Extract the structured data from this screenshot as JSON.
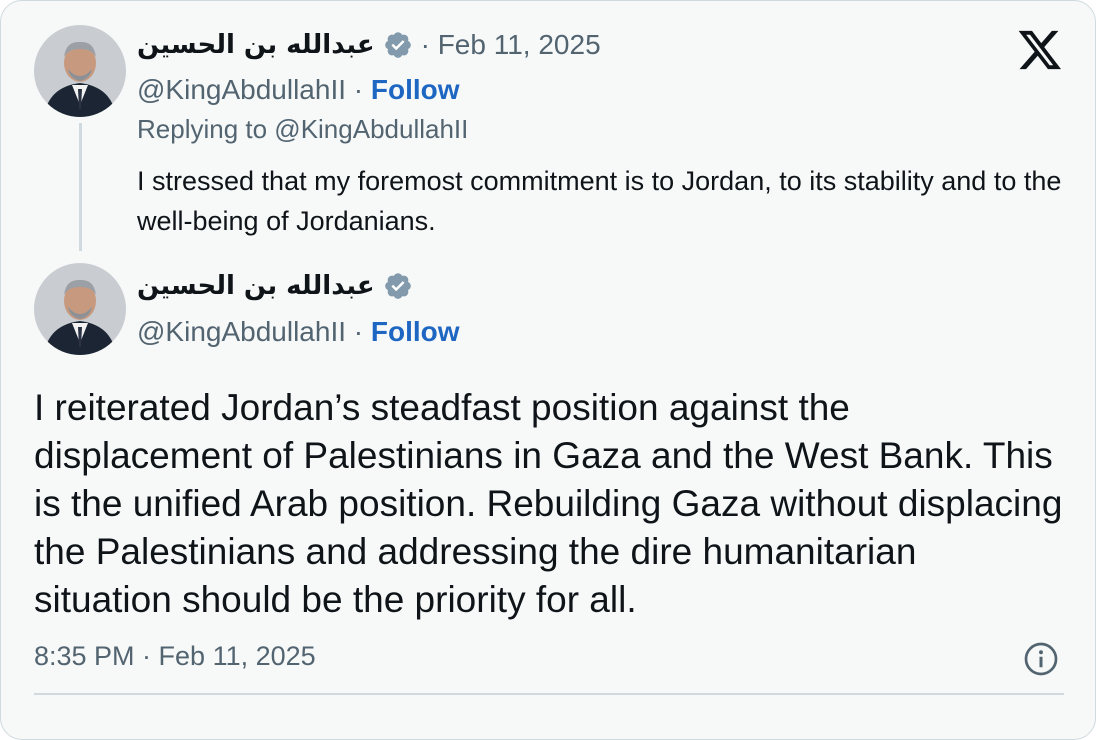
{
  "reply_tweet": {
    "display_name": "عبدالله بن الحسين",
    "date": "· Feb 11, 2025",
    "handle": "@KingAbdullahII",
    "separator": "·",
    "follow_label": "Follow",
    "replying_to": "Replying to @KingAbdullahII",
    "text": "I stressed that my foremost commitment is to Jordan, to its stability and to the well-being of Jordanians."
  },
  "main_tweet": {
    "display_name": "عبدالله بن الحسين",
    "handle": "@KingAbdullahII",
    "separator": "·",
    "follow_label": "Follow",
    "text": "I reiterated Jordan’s steadfast position against the displacement of Palestinians in Gaza and the West Bank. This is the unified Arab position. Rebuilding Gaza without displacing the Palestinians and addressing the dire humanitarian situation should be the priority for all.",
    "timestamp": "8:35 PM · Feb 11, 2025"
  },
  "icons": {
    "platform_logo": "x-logo-icon",
    "verified": "verified-badge-icon",
    "info": "info-icon"
  },
  "colors": {
    "background": "#f7f9f9",
    "text": "#0f1419",
    "muted": "#536471",
    "follow": "#1d66c2",
    "border": "#cfd9de",
    "verified": "#829aab"
  }
}
